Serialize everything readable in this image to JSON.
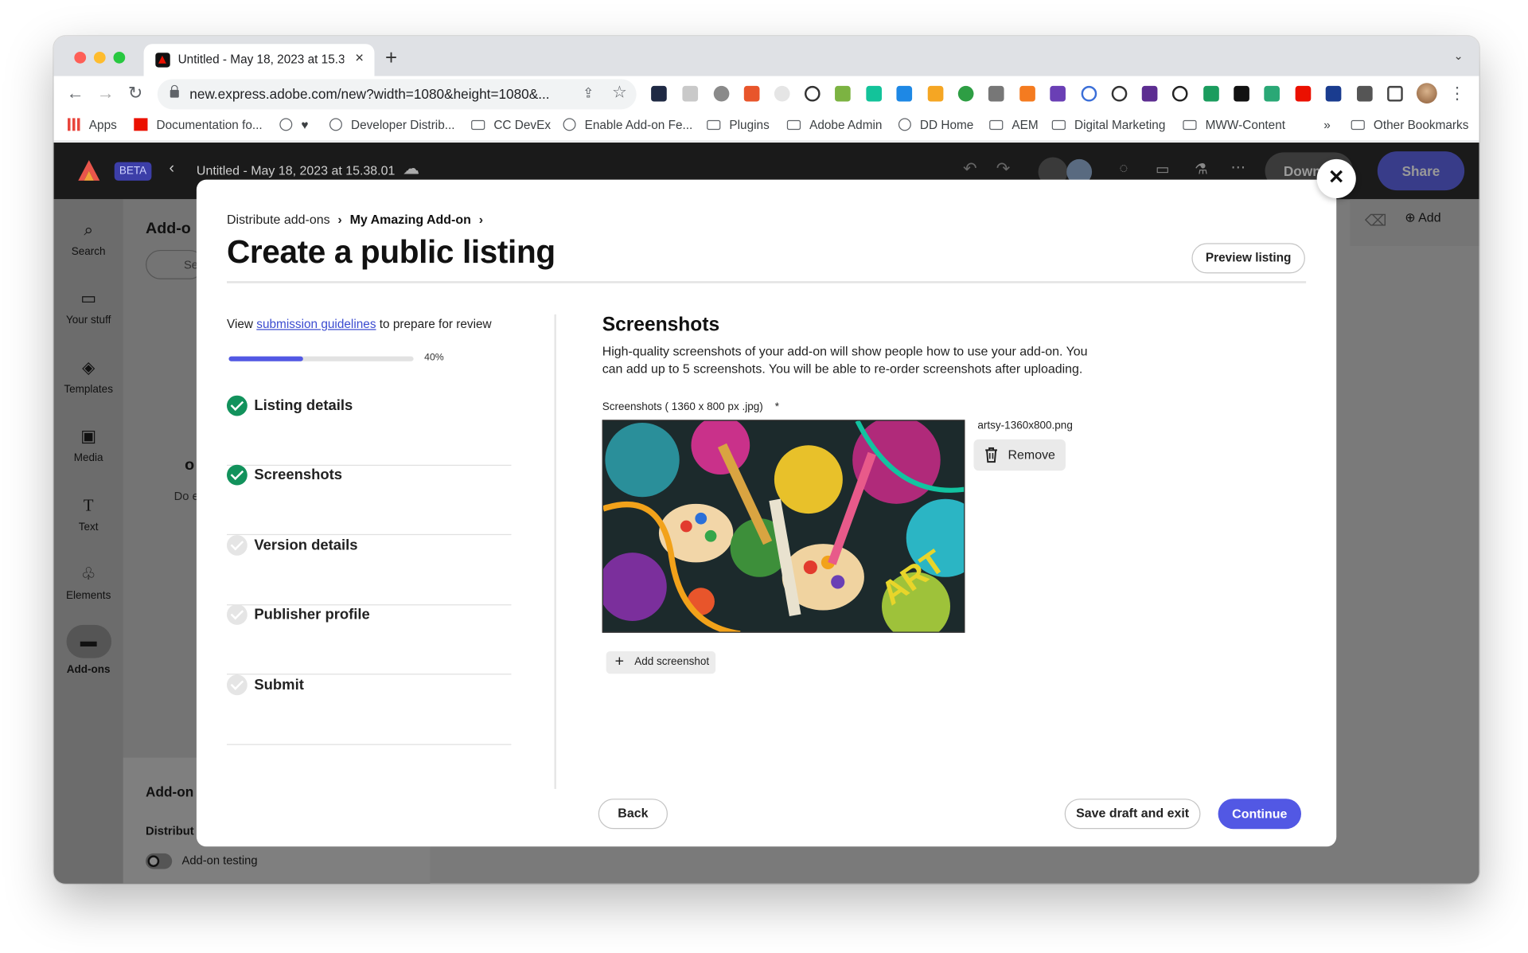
{
  "browser": {
    "tab_title": "Untitled - May 18, 2023 at 15.3",
    "url": "new.express.adobe.com/new?width=1080&height=1080&...",
    "bookmarks": [
      "Apps",
      "Documentation fo...",
      "Developer Distrib...",
      "CC DevEx",
      "Enable Add-on Fe...",
      "Plugins",
      "Adobe Admin",
      "DD Home",
      "AEM",
      "Digital Marketing",
      "MWW-Content",
      "Other Bookmarks"
    ],
    "bookmarks_more": "»",
    "traffic_colors": [
      "#fe5f57",
      "#febc2e",
      "#28c840"
    ]
  },
  "app": {
    "beta_label": "BETA",
    "doc_title": "Untitled - May 18, 2023 at 15.38.01",
    "download_label": "Down",
    "share_label": "Share",
    "add_label": "Add",
    "panel_title": "Add-o",
    "panel_search": "Se",
    "panel_o": "o",
    "panel_do": "Do e",
    "panel_bottom_title": "Add-on",
    "panel_distrib": "Distribut",
    "addon_testing": "Add-on testing",
    "sidebar": [
      {
        "label": "Search",
        "icon": "search-icon"
      },
      {
        "label": "Your stuff",
        "icon": "folder-icon"
      },
      {
        "label": "Templates",
        "icon": "templates-icon"
      },
      {
        "label": "Media",
        "icon": "media-icon"
      },
      {
        "label": "Text",
        "icon": "text-icon"
      },
      {
        "label": "Elements",
        "icon": "elements-icon"
      },
      {
        "label": "Add-ons",
        "icon": "addons-icon"
      }
    ]
  },
  "modal": {
    "breadcrumb": [
      "Distribute add-ons",
      "My Amazing Add-on"
    ],
    "title": "Create a public listing",
    "preview_label": "Preview listing",
    "guide_prefix": "View",
    "guide_link": "submission guidelines",
    "guide_suffix": "to prepare for review",
    "progress": 0.4,
    "progress_label": "40%",
    "steps": [
      {
        "label": "Listing details",
        "done": true
      },
      {
        "label": "Screenshots",
        "done": true
      },
      {
        "label": "Version details",
        "done": false
      },
      {
        "label": "Publisher profile",
        "done": false
      },
      {
        "label": "Submit",
        "done": false
      }
    ],
    "section_title": "Screenshots",
    "section_desc": "High-quality screenshots of your add-on will show people how to use your add-on. You can add up to 5 screenshots. You will be able to re-order screenshots after uploading.",
    "screens_label": "Screenshots ( 1360 x 800 px .jpg)",
    "required_mark": "*",
    "file_name": "artsy-1360x800.png",
    "remove_label": "Remove",
    "add_screenshot": "Add screenshot",
    "back_label": "Back",
    "save_label": "Save draft and exit",
    "continue_label": "Continue",
    "accent": "#5258e4",
    "success": "#12925c"
  }
}
